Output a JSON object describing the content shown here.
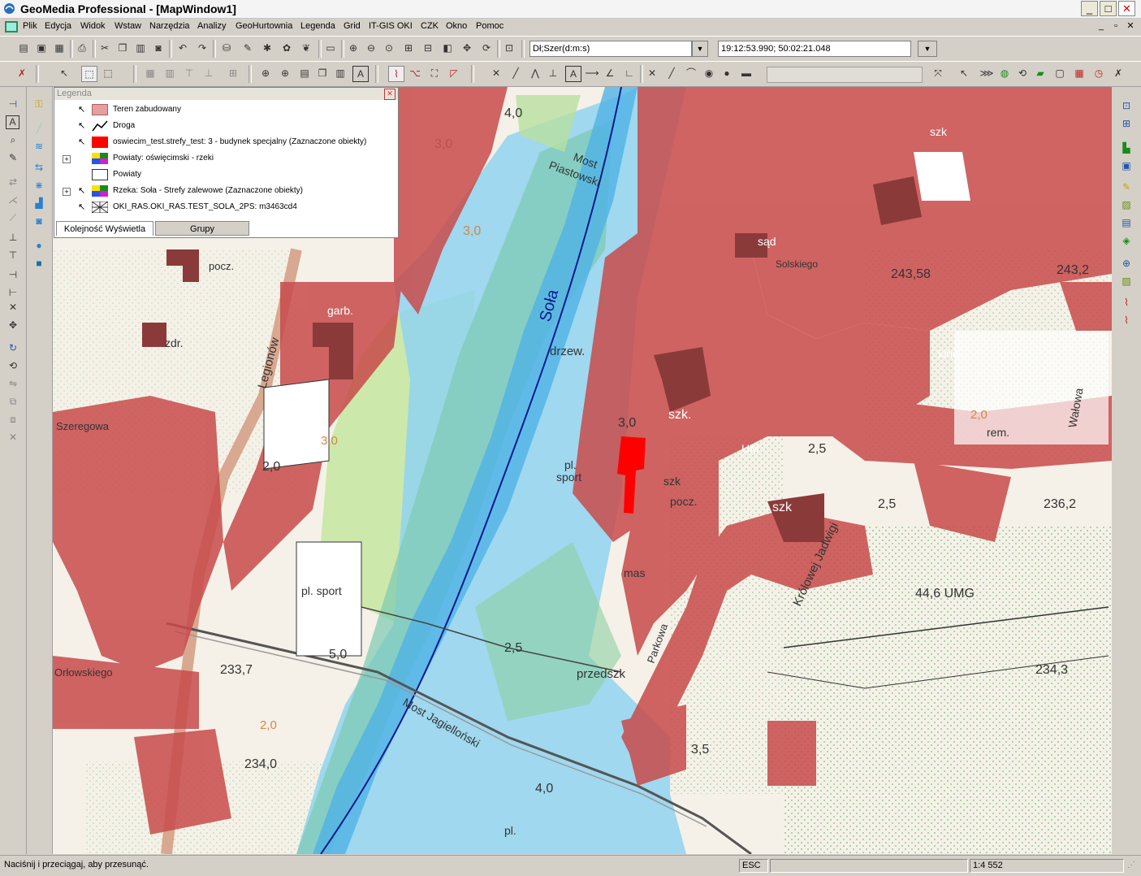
{
  "titlebar": {
    "title": "GeoMedia Professional - [MapWindow1]",
    "minimize": "_",
    "maximize": "□",
    "close": "✕"
  },
  "menubar": {
    "items": [
      "Plik",
      "Edycja",
      "Widok",
      "Wstaw",
      "Narzędzia",
      "Analizy",
      "GeoHurtownia",
      "Legenda",
      "Grid",
      "IT-GIS OKI",
      "CZK",
      "Okno",
      "Pomoc"
    ],
    "mdi_min": "_",
    "mdi_restore": "▫",
    "mdi_close": "✕"
  },
  "toolbar": {
    "coord_system": "Dł;Szer(d:m:s)",
    "coordinates": "19:12:53.990; 50:02:21.048"
  },
  "legend": {
    "header": "Legenda",
    "entries": [
      {
        "label": "Teren zabudowany",
        "swatch_color": "#e4a0a0",
        "expand": false
      },
      {
        "label": "Droga",
        "swatch_color": "line",
        "expand": false
      },
      {
        "label": "oswiecim_test.strefy_test: 3 - budynek specjalny (Zaznaczone obiekty)",
        "swatch_color": "#ff0000",
        "expand": false
      },
      {
        "label": "Powiaty: oświęcimski - rzeki",
        "swatch_color": "multi",
        "expand": true
      },
      {
        "label": "Powiaty",
        "swatch_color": "#ffffff",
        "expand": false
      },
      {
        "label": "Rzeka: Soła - Strefy zalewowe (Zaznaczone obiekty)",
        "swatch_color": "multi",
        "expand": true
      },
      {
        "label": "OKI_RAS.OKI_RAS.TEST_SOLA_2PS: m3463cd4",
        "swatch_color": "raster",
        "expand": false
      }
    ],
    "tabs": [
      "Kolejność Wyświetla",
      "Grupy"
    ]
  },
  "map": {
    "labels": [
      {
        "text": "4,0"
      },
      {
        "text": "3,0"
      },
      {
        "text": "2,0"
      },
      {
        "text": "3,0"
      },
      {
        "text": "Most"
      },
      {
        "text": "Piastowski"
      },
      {
        "text": "3,0"
      },
      {
        "text": "Soła"
      },
      {
        "text": "drzew."
      },
      {
        "text": "3,0"
      },
      {
        "text": "szk."
      },
      {
        "text": "pl."
      },
      {
        "text": "sport"
      },
      {
        "text": "szk"
      },
      {
        "text": "pocz."
      },
      {
        "text": "2,0"
      },
      {
        "text": "pl. sport"
      },
      {
        "text": "mas"
      },
      {
        "text": "2,5"
      },
      {
        "text": "5,0"
      },
      {
        "text": "przedszk"
      },
      {
        "text": "233,7"
      },
      {
        "text": "234,0"
      },
      {
        "text": "Most Jagielloński"
      },
      {
        "text": "4,0"
      },
      {
        "text": "pl."
      },
      {
        "text": "3,5"
      },
      {
        "text": "garb."
      },
      {
        "text": "zdr."
      },
      {
        "text": "pocz."
      },
      {
        "text": "Orłowskiego"
      },
      {
        "text": "Szeregowa"
      },
      {
        "text": "Legionów"
      },
      {
        "text": "sąd"
      },
      {
        "text": "Solskiego"
      },
      {
        "text": "243,58"
      },
      {
        "text": "243,2"
      },
      {
        "text": "kino"
      },
      {
        "text": "UM"
      },
      {
        "text": "2,5"
      },
      {
        "text": "szk"
      },
      {
        "text": "2,5"
      },
      {
        "text": "236,2"
      },
      {
        "text": "44,6 UMG"
      },
      {
        "text": "234,3"
      },
      {
        "text": "Królowej Jadwigi"
      },
      {
        "text": "rem."
      },
      {
        "text": "Parkowa"
      },
      {
        "text": "2,0"
      },
      {
        "text": "szk"
      },
      {
        "text": "Wałowa"
      }
    ]
  },
  "statusbar": {
    "message": "Naciśnij i przeciągaj, aby przesunąć.",
    "key": "ESC",
    "scale": "1:4 552"
  },
  "colors": {
    "built_up": "#c84b4b",
    "flood_blue": "#8fd3f0",
    "flood_green": "#8ccf9a",
    "selected": "#ff0000",
    "river_line": "#0a1a8c"
  }
}
